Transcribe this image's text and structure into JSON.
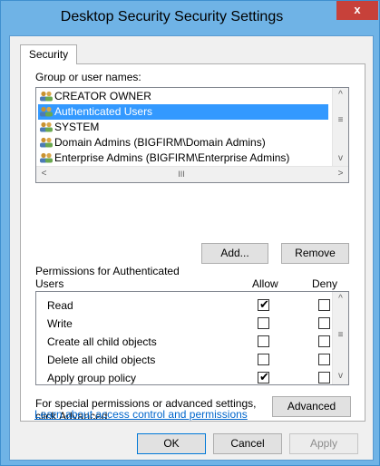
{
  "window": {
    "title": "Desktop Security Security Settings",
    "close_label": "x"
  },
  "tabs": [
    "Security"
  ],
  "group_label": "Group or user names:",
  "users": [
    {
      "name": "CREATOR OWNER",
      "selected": false
    },
    {
      "name": "Authenticated Users",
      "selected": true
    },
    {
      "name": "SYSTEM",
      "selected": false
    },
    {
      "name": "Domain Admins (BIGFIRM\\Domain Admins)",
      "selected": false
    },
    {
      "name": "Enterprise Admins (BIGFIRM\\Enterprise Admins)",
      "selected": false
    }
  ],
  "scroll_glyphs": {
    "up": "^",
    "down": "v",
    "left": "<",
    "right": ">",
    "grip": "≡",
    "hgrip": "III"
  },
  "buttons": {
    "add": "Add...",
    "remove": "Remove",
    "advanced": "Advanced",
    "ok": "OK",
    "cancel": "Cancel",
    "apply": "Apply"
  },
  "permissions_label_line1": "Permissions for Authenticated",
  "permissions_label_line2": "Users",
  "col_allow": "Allow",
  "col_deny": "Deny",
  "permissions": [
    {
      "name": "Read",
      "allow": true,
      "deny": false
    },
    {
      "name": "Write",
      "allow": false,
      "deny": false
    },
    {
      "name": "Create all child objects",
      "allow": false,
      "deny": false
    },
    {
      "name": "Delete all child objects",
      "allow": false,
      "deny": false
    },
    {
      "name": "Apply group policy",
      "allow": true,
      "deny": false
    }
  ],
  "check_glyph": "✔",
  "special_line1": "For special permissions or advanced settings,",
  "special_line2": "click Advanced.",
  "learn_link": "Learn about access control and permissions",
  "colors": {
    "selection": "#3399ff",
    "link": "#0066cc",
    "close": "#c7413a",
    "frame": "#6fb3e6"
  }
}
